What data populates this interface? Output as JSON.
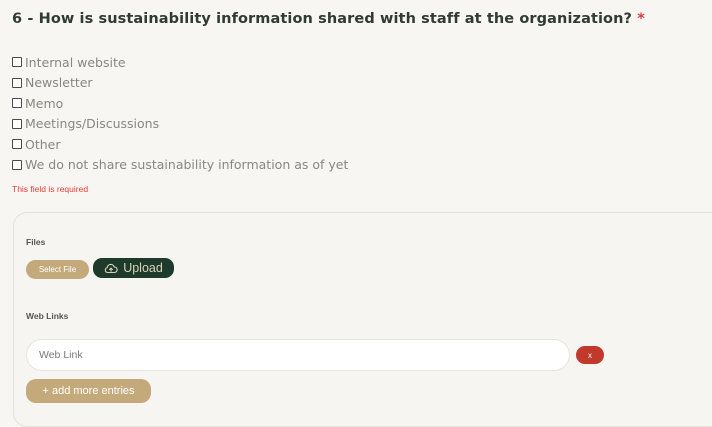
{
  "question": {
    "title": "6 - How is sustainability information shared with staff at the organization?",
    "required_marker": "*"
  },
  "options": [
    {
      "label": "Internal website",
      "checked": false
    },
    {
      "label": "Newsletter",
      "checked": false
    },
    {
      "label": "Memo",
      "checked": false
    },
    {
      "label": "Meetings/Discussions",
      "checked": false
    },
    {
      "label": "Other",
      "checked": false
    },
    {
      "label": "We do not share sustainability information as of yet",
      "checked": false
    }
  ],
  "validation": {
    "error": "This field is required"
  },
  "files": {
    "label": "Files",
    "select_button": "Select File",
    "upload_button": "Upload",
    "upload_icon": "cloud-upload-icon"
  },
  "web_links": {
    "label": "Web Links",
    "input_placeholder": "Web Link",
    "input_value": "",
    "remove_button": "x",
    "add_more_button": "+ add more entries"
  },
  "colors": {
    "required": "#e53935",
    "title": "#2f3b33",
    "option_text": "#8a8680",
    "select_button": "#c4a97a",
    "upload_button": "#1e3a2a",
    "remove_button": "#c0392b"
  }
}
